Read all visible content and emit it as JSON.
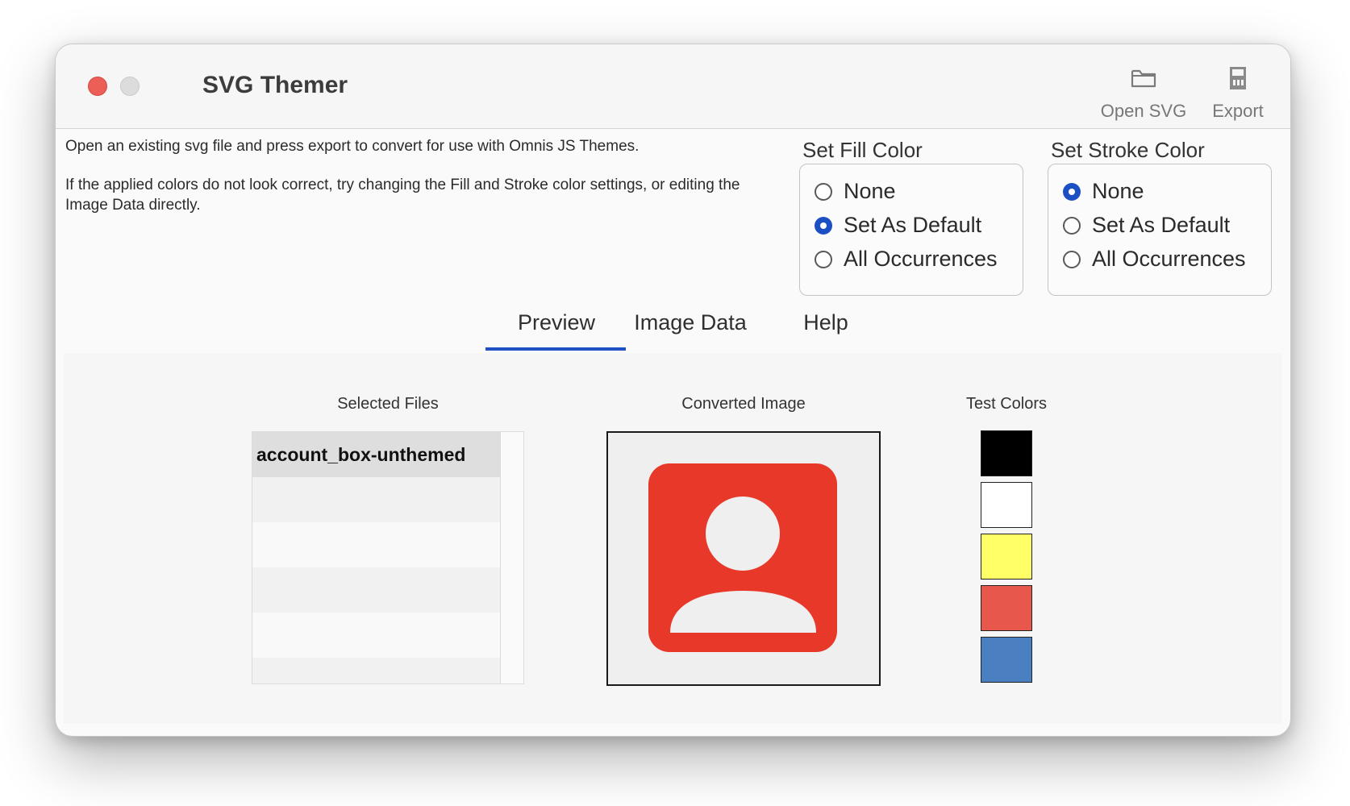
{
  "window": {
    "title": "SVG Themer"
  },
  "toolbar": {
    "open_label": "Open SVG",
    "export_label": "Export"
  },
  "description": {
    "line1": "Open an existing svg file and press export to convert for use with Omnis JS Themes.",
    "line2": "If the applied colors do not look correct, try changing the Fill and Stroke color settings, or editing the Image Data directly."
  },
  "fill_group": {
    "title": "Set Fill Color",
    "options": [
      "None",
      "Set As Default",
      "All Occurrences"
    ],
    "selected": "Set As Default"
  },
  "stroke_group": {
    "title": "Set Stroke Color",
    "options": [
      "None",
      "Set As Default",
      "All Occurrences"
    ],
    "selected": "None"
  },
  "tabs": [
    {
      "label": "Preview",
      "active": true
    },
    {
      "label": "Image Data",
      "active": false
    },
    {
      "label": "Help",
      "active": false
    }
  ],
  "preview": {
    "files_label": "Selected Files",
    "files": [
      "account_box-unthemed"
    ],
    "image_label": "Converted Image",
    "image_icon": "account-box-icon",
    "image_color": "#e8382a",
    "test_colors_label": "Test Colors",
    "test_colors": [
      "#000000",
      "#ffffff",
      "#ffff66",
      "#e8574b",
      "#4a7fc1"
    ]
  },
  "colors": {
    "accent": "#1d4fc4",
    "close_button": "#ec5f57"
  }
}
